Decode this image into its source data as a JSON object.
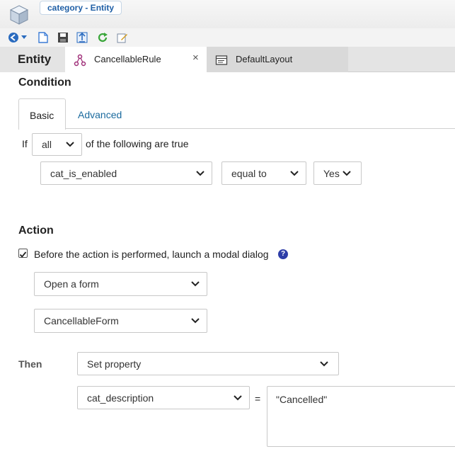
{
  "titlebar": {
    "title": "category - Entity",
    "app_icon": "cube-icon"
  },
  "toolbar": {
    "items": [
      {
        "name": "back-arrow-icon",
        "color": "#2a6bbf"
      },
      {
        "name": "dropdown-arrow-icon",
        "color": "#2a6bbf"
      },
      {
        "name": "new-document-icon",
        "color": "#3a7bd5"
      },
      {
        "name": "save-icon",
        "color": "#444444"
      },
      {
        "name": "export-icon",
        "color": "#2a6bbf"
      },
      {
        "name": "refresh-icon",
        "color": "#3aa63a"
      },
      {
        "name": "edit-icon",
        "color": "#d49b1c"
      }
    ]
  },
  "tabs": {
    "entity_label": "Entity",
    "items": [
      {
        "label": "CancellableRule",
        "icon": "rule-icon",
        "close": "×",
        "active": true
      },
      {
        "label": "DefaultLayout",
        "icon": "layout-icon",
        "active": false
      }
    ]
  },
  "condition": {
    "title": "Condition",
    "tabs": {
      "basic": "Basic",
      "advanced": "Advanced"
    },
    "if_label": "If",
    "quantifier": "all",
    "suffix": "of the following are true",
    "field": "cat_is_enabled",
    "operator": "equal to",
    "value": "Yes"
  },
  "action": {
    "title": "Action",
    "checkbox_checked": true,
    "checkbox_label": "Before the action is performed, launch a modal dialog",
    "help": "?",
    "dialog_type": "Open a form",
    "form_name": "CancellableForm"
  },
  "then": {
    "label": "Then",
    "action_type": "Set property",
    "property": "cat_description",
    "equals": "=",
    "value": "\"Cancelled\""
  },
  "colors": {
    "accent": "#1a6a9e",
    "help_badge": "#2e3ea8",
    "tab_bg": "#e4e4e4"
  }
}
